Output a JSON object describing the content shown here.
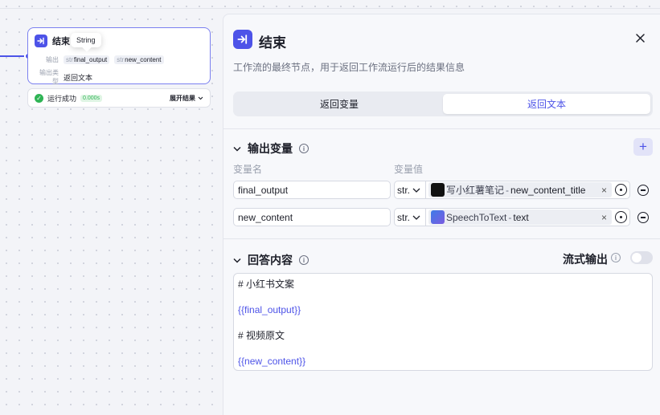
{
  "canvas": {
    "node": {
      "title": "结束",
      "tooltip": "String",
      "output_label": "输出",
      "outputs": [
        {
          "type": "str",
          "name": "final_output"
        },
        {
          "type": "str",
          "name": "new_content"
        }
      ],
      "output_type_label": "输出类型",
      "output_type_value": "返回文本"
    },
    "run": {
      "status": "运行成功",
      "time": "0.000s",
      "expand_label": "展开结果"
    }
  },
  "panel": {
    "title": "结束",
    "description": "工作流的最终节点，用于返回工作流运行后的结果信息",
    "tabs": [
      {
        "label": "返回变量",
        "active": false
      },
      {
        "label": "返回文本",
        "active": true
      }
    ],
    "output_section": {
      "title": "输出变量",
      "col_name": "变量名",
      "col_value": "变量值",
      "rows": [
        {
          "name": "final_output",
          "type": "str.",
          "ref_node": "写小红薯笔记",
          "ref_sep": "-",
          "ref_var": "new_content_title",
          "icon": "xiaohongshu-node-icon"
        },
        {
          "name": "new_content",
          "type": "str.",
          "ref_node": "SpeechToText",
          "ref_sep": "-",
          "ref_var": "text",
          "icon": "speech-to-text-node-icon"
        }
      ]
    },
    "answer_section": {
      "title": "回答内容",
      "stream_label": "流式输出",
      "stream_enabled": false,
      "lines": [
        {
          "text": "# 小红书文案",
          "is_var": false
        },
        {
          "text": "{{final_output}}",
          "is_var": true
        },
        {
          "text": "# 视频原文",
          "is_var": false
        },
        {
          "text": "{{new_content}}",
          "is_var": true
        }
      ]
    }
  },
  "colors": {
    "accent": "#4d53e8",
    "success": "#2fb455"
  }
}
